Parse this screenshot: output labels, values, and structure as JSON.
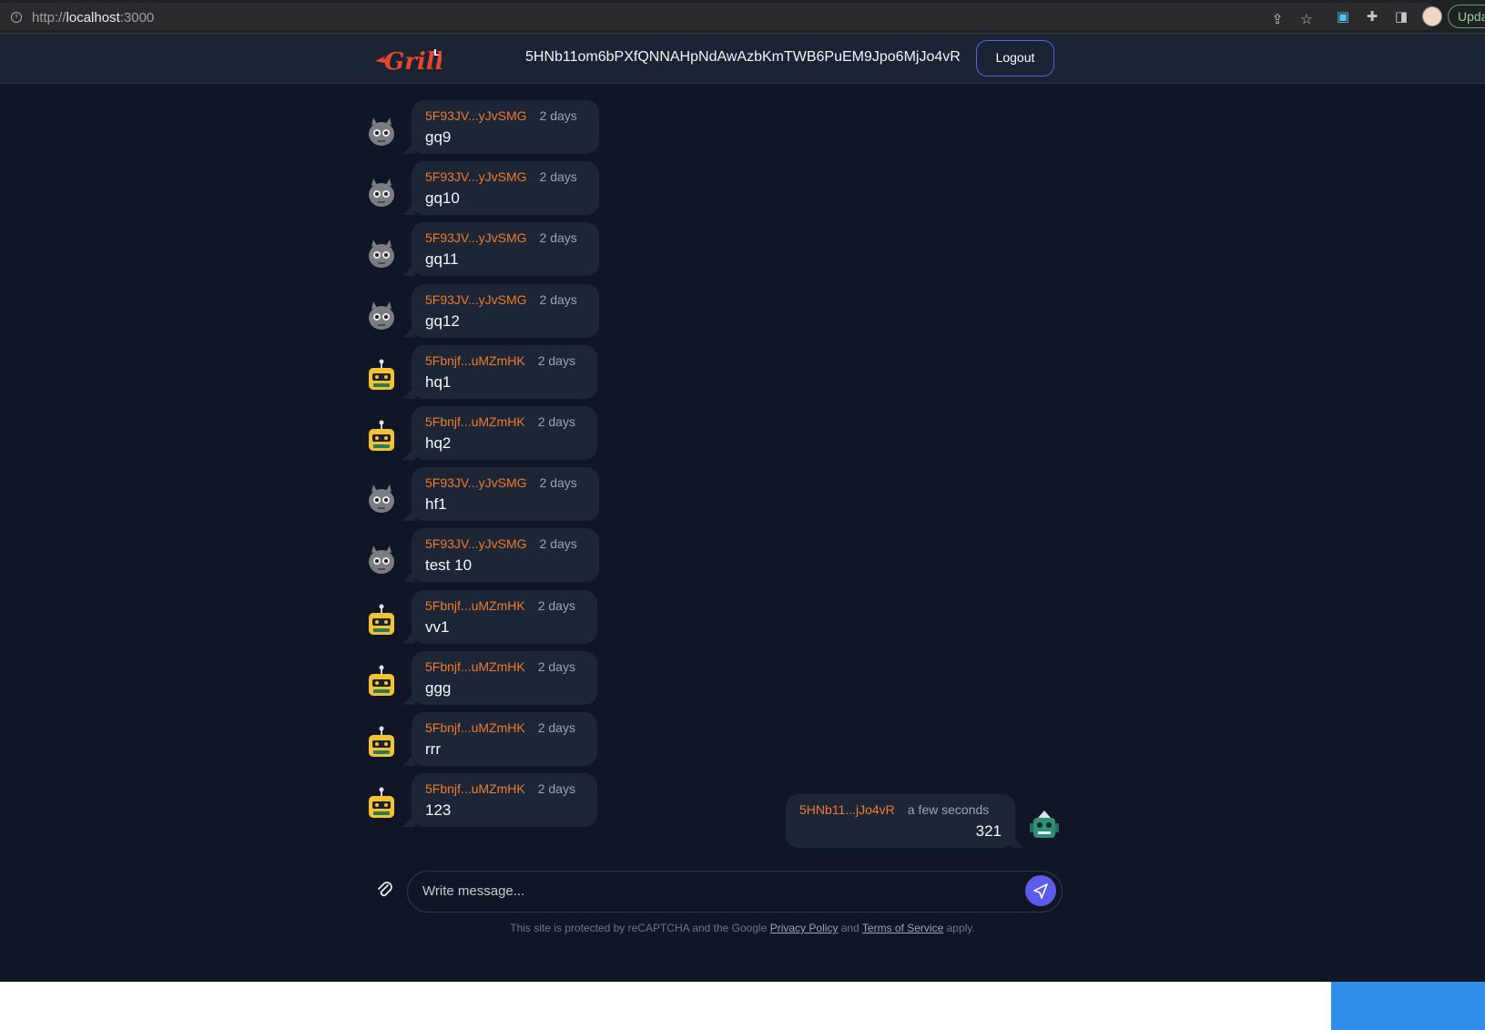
{
  "browser": {
    "url_scheme": "http://",
    "url_host": "localhost",
    "url_port": ":3000",
    "update_label": "Upda"
  },
  "header": {
    "address": "5HNb11om6bPXfQNNAHpNdAwAzbKmTWB6PuEM9Jpo6MjJo4vR",
    "logout_label": "Logout"
  },
  "messages": [
    {
      "author": "5F93JV...yJvSMG",
      "time": "2 days",
      "text": "gq9",
      "avatar": "gray-bot-avatar"
    },
    {
      "author": "5F93JV...yJvSMG",
      "time": "2 days",
      "text": "gq10",
      "avatar": "gray-bot-avatar"
    },
    {
      "author": "5F93JV...yJvSMG",
      "time": "2 days",
      "text": "gq11",
      "avatar": "gray-bot-avatar"
    },
    {
      "author": "5F93JV...yJvSMG",
      "time": "2 days",
      "text": "gq12",
      "avatar": "gray-bot-avatar"
    },
    {
      "author": "5Fbnjf...uMZmHK",
      "time": "2 days",
      "text": "hq1",
      "avatar": "yellow-bot-avatar"
    },
    {
      "author": "5Fbnjf...uMZmHK",
      "time": "2 days",
      "text": "hq2",
      "avatar": "yellow-bot-avatar"
    },
    {
      "author": "5F93JV...yJvSMG",
      "time": "2 days",
      "text": "hf1",
      "avatar": "gray-bot-avatar"
    },
    {
      "author": "5F93JV...yJvSMG",
      "time": "2 days",
      "text": "test 10",
      "avatar": "gray-bot-avatar"
    },
    {
      "author": "5Fbnjf...uMZmHK",
      "time": "2 days",
      "text": "vv1",
      "avatar": "yellow-bot-avatar"
    },
    {
      "author": "5Fbnjf...uMZmHK",
      "time": "2 days",
      "text": "ggg",
      "avatar": "yellow-bot-avatar"
    },
    {
      "author": "5Fbnjf...uMZmHK",
      "time": "2 days",
      "text": "rrr",
      "avatar": "yellow-bot-avatar"
    },
    {
      "author": "5Fbnjf...uMZmHK",
      "time": "2 days",
      "text": "123",
      "avatar": "yellow-bot-avatar"
    }
  ],
  "own_message": {
    "author": "5HNb11...jJo4vR",
    "time": "a few seconds",
    "text": "321",
    "avatar": "green-bot-avatar"
  },
  "composer": {
    "placeholder": "Write message...",
    "recaptcha_prefix": "This site is protected by reCAPTCHA and the Google",
    "privacy_link": "Privacy Policy",
    "and": "and",
    "terms_link": "Terms of Service",
    "suffix": "apply."
  },
  "colors": {
    "background": "#111627",
    "header": "#1b2435",
    "bubble": "#1d2637",
    "author": "#f07a2a",
    "accent": "#5b5ce9"
  }
}
